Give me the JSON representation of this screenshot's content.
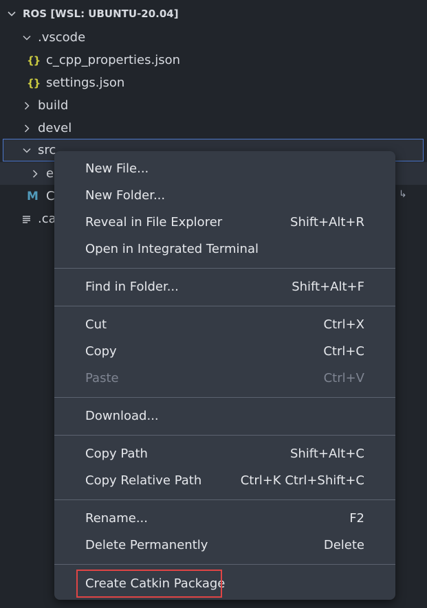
{
  "explorer": {
    "section_title": "ROS [WSL: UBUNTU-20.04]",
    "tree": [
      {
        "label": ".vscode",
        "kind": "folder-open"
      },
      {
        "label": "c_cpp_properties.json",
        "kind": "json"
      },
      {
        "label": "settings.json",
        "kind": "json"
      },
      {
        "label": "build",
        "kind": "folder-closed"
      },
      {
        "label": "devel",
        "kind": "folder-closed"
      },
      {
        "label": "src",
        "kind": "folder-open"
      },
      {
        "label": "e",
        "kind": "folder-closed"
      },
      {
        "label": "C",
        "kind": "cmake"
      },
      {
        "label": ".ca",
        "kind": "text"
      }
    ]
  },
  "menu": {
    "new_file": "New File...",
    "new_folder": "New Folder...",
    "reveal": {
      "label": "Reveal in File Explorer",
      "shortcut": "Shift+Alt+R"
    },
    "open_terminal": "Open in Integrated Terminal",
    "find_in_folder": {
      "label": "Find in Folder...",
      "shortcut": "Shift+Alt+F"
    },
    "cut": {
      "label": "Cut",
      "shortcut": "Ctrl+X"
    },
    "copy": {
      "label": "Copy",
      "shortcut": "Ctrl+C"
    },
    "paste": {
      "label": "Paste",
      "shortcut": "Ctrl+V",
      "disabled": true
    },
    "download": "Download...",
    "copy_path": {
      "label": "Copy Path",
      "shortcut": "Shift+Alt+C"
    },
    "copy_relative_path": {
      "label": "Copy Relative Path",
      "shortcut": "Ctrl+K Ctrl+Shift+C"
    },
    "rename": {
      "label": "Rename...",
      "shortcut": "F2"
    },
    "delete": {
      "label": "Delete Permanently",
      "shortcut": "Delete"
    },
    "create_catkin": "Create Catkin Package"
  },
  "colors": {
    "background": "#21252b",
    "menu_background": "#353b45",
    "selection_border": "#4d78cc",
    "highlight_border": "#e04545",
    "json_icon": "#cbcb41",
    "cmake_icon": "#519aba"
  },
  "icons": {
    "section": "chevron-down-icon",
    "folder_open": "chevron-down-icon",
    "folder_closed": "chevron-right-icon",
    "json": "json-braces-icon",
    "cmake": "cmake-m-icon",
    "text": "text-lines-icon",
    "corner": "return-arrow-icon"
  }
}
